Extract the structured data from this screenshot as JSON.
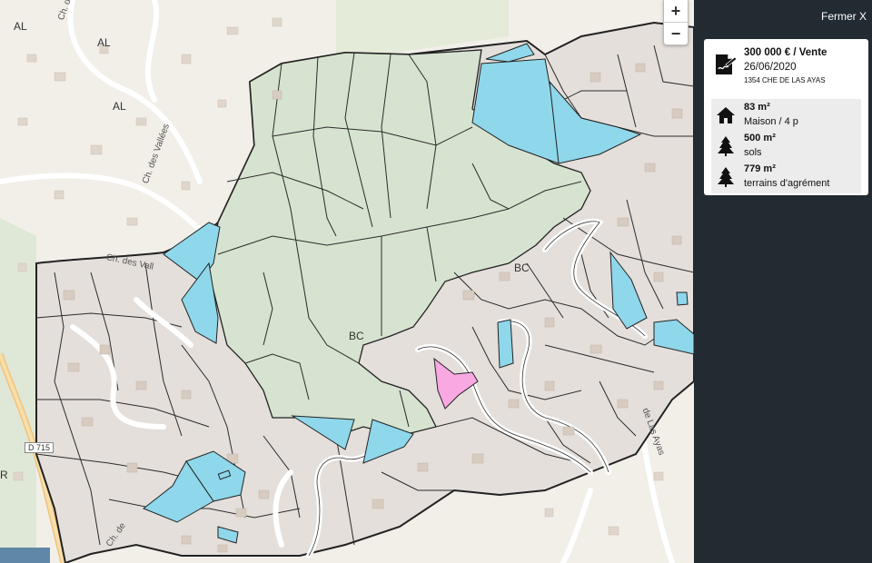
{
  "map": {
    "labels": {
      "al1": "AL",
      "al2": "AL",
      "al3": "AL",
      "bc1": "BC",
      "bc2": "BC",
      "r": "R"
    },
    "roads": {
      "ch_vall1": "Ch. des Vall",
      "ch_vall2": "Ch. des Vallées",
      "ch_vall3": "Ch. des Vallées",
      "ch_vall4": "Ch. des Vall",
      "las_ayas": "de Las Ayas",
      "ch_lower": "Ch. de",
      "d715": "D 715"
    },
    "zoom": {
      "in": "+",
      "out": "−"
    },
    "colors": {
      "land": "#f2efe9",
      "forest": "#d6e3d0",
      "sold_parcel": "#8fd7ea",
      "selected_parcel": "#f9a8e2",
      "parcel_line": "#222222"
    }
  },
  "panel": {
    "close_label": "Fermer X",
    "sale": {
      "price": "300 000 € / Vente",
      "date": "26/06/2020",
      "address": "1354 CHE DE LAS AYAS"
    },
    "details": [
      {
        "icon": "house-icon",
        "value": "83 m²",
        "label": "Maison / 4 p"
      },
      {
        "icon": "tree-icon",
        "value": "500 m²",
        "label": "sols"
      },
      {
        "icon": "tree-icon",
        "value": "779 m²",
        "label": "terrains d'agrément"
      }
    ]
  }
}
